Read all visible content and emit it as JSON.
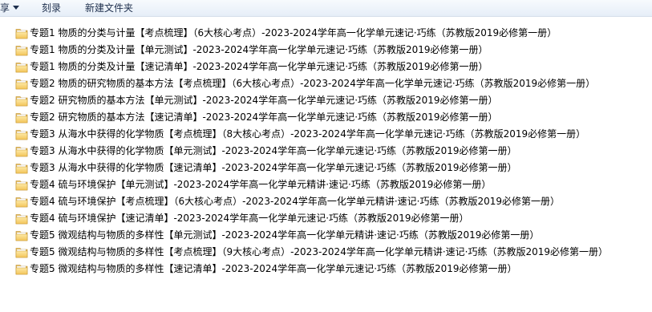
{
  "toolbar": {
    "share_label": "享",
    "burn_label": "刻录",
    "newfolder_label": "新建文件夹"
  },
  "files": [
    {
      "name": "专题1  物质的分类与计量【考点梳理】（6大核心考点）-2023-2024学年高一化学单元速记·巧练（苏教版2019必修第一册）"
    },
    {
      "name": "专题1 物质的分类及计量【单元测试】-2023-2024学年高一化学单元速记·巧练（苏教版2019必修第一册）"
    },
    {
      "name": "专题1 物质的分类及计量【速记清单】-2023-2024学年高一化学单元速记·巧练（苏教版2019必修第一册）"
    },
    {
      "name": "专题2  物质的研究物质的基本方法【考点梳理】（6大核心考点）-2023-2024学年高一化学单元速记·巧练（苏教版2019必修第一册）"
    },
    {
      "name": "专题2 研究物质的基本方法【单元测试】-2023-2024学年高一化学单元速记·巧练（苏教版2019必修第一册）"
    },
    {
      "name": "专题2 研究物质的基本方法【速记清单】-2023-2024学年高一化学单元速记·巧练（苏教版2019必修第一册）"
    },
    {
      "name": "专题3  从海水中获得的化学物质【考点梳理】（8大核心考点）-2023-2024学年高一化学单元速记·巧练（苏教版2019必修第一册）"
    },
    {
      "name": "专题3 从海水中获得的化学物质【单元测试】-2023-2024学年高一化学单元速记·巧练（苏教版2019必修第一册）"
    },
    {
      "name": "专题3 从海水中获得的化学物质【速记清单】-2023-2024学年高一化学单元速记·巧练（苏教版2019必修第一册）"
    },
    {
      "name": "专题4  硫与环境保护【单元测试】-2023-2024学年高一化学单元精讲·速记·巧练（苏教版2019必修第一册）"
    },
    {
      "name": "专题4  硫与环境保护【考点梳理】（6大核心考点）-2023-2024学年高一化学单元精讲·速记·巧练（苏教版2019必修第一册）"
    },
    {
      "name": "专题4 硫与环境保护【速记清单】-2023-2024学年高一化学单元速记·巧练（苏教版2019必修第一册）"
    },
    {
      "name": "专题5  微观结构与物质的多样性【单元测试】-2023-2024学年高一化学单元精讲·速记·巧练（苏教版2019必修第一册）"
    },
    {
      "name": "专题5  微观结构与物质的多样性【考点梳理】（9大核心考点）-2023-2024学年高一化学单元精讲·速记·巧练（苏教版2019必修第一册）"
    },
    {
      "name": "专题5 微观结构与物质的多样性【速记清单】-2023-2024学年高一化学单元速记·巧练（苏教版2019必修第一册）"
    }
  ]
}
